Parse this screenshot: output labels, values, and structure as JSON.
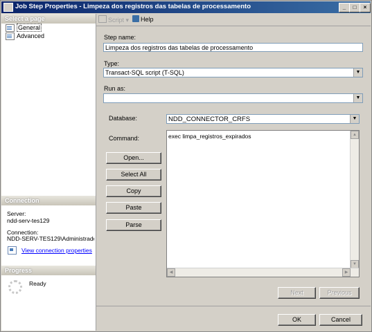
{
  "window": {
    "title": "Job Step Properties - Limpeza dos registros das tabelas de processamento"
  },
  "left_panel": {
    "select_page_header": "Select a page",
    "pages": [
      {
        "label": "General",
        "selected": true
      },
      {
        "label": "Advanced",
        "selected": false
      }
    ],
    "connection_header": "Connection",
    "server_label": "Server:",
    "server_value": "ndd-serv-tes129",
    "connection_label": "Connection:",
    "connection_value": "NDD-SERV-TES129\\Administrado",
    "view_connection_link": "View connection properties",
    "progress_header": "Progress",
    "progress_status": "Ready"
  },
  "toolbar": {
    "script_label": "Script",
    "help_label": "Help"
  },
  "form": {
    "step_name_label": "Step name:",
    "step_name_value": "Limpeza dos registros das tabelas de processamento",
    "type_label": "Type:",
    "type_value": "Transact-SQL script (T-SQL)",
    "run_as_label": "Run as:",
    "run_as_value": "",
    "database_label": "Database:",
    "database_value": "NDD_CONNECTOR_CRFS",
    "command_label": "Command:",
    "command_text": "exec limpa_registros_expirados"
  },
  "buttons": {
    "open": "Open...",
    "select_all": "Select All",
    "copy": "Copy",
    "paste": "Paste",
    "parse": "Parse",
    "next": "Next",
    "previous": "Previous",
    "ok": "OK",
    "cancel": "Cancel"
  },
  "colors": {
    "title_bar": "#0a246a",
    "link": "#0000ff",
    "dialog_bg": "#d4d0c8"
  }
}
